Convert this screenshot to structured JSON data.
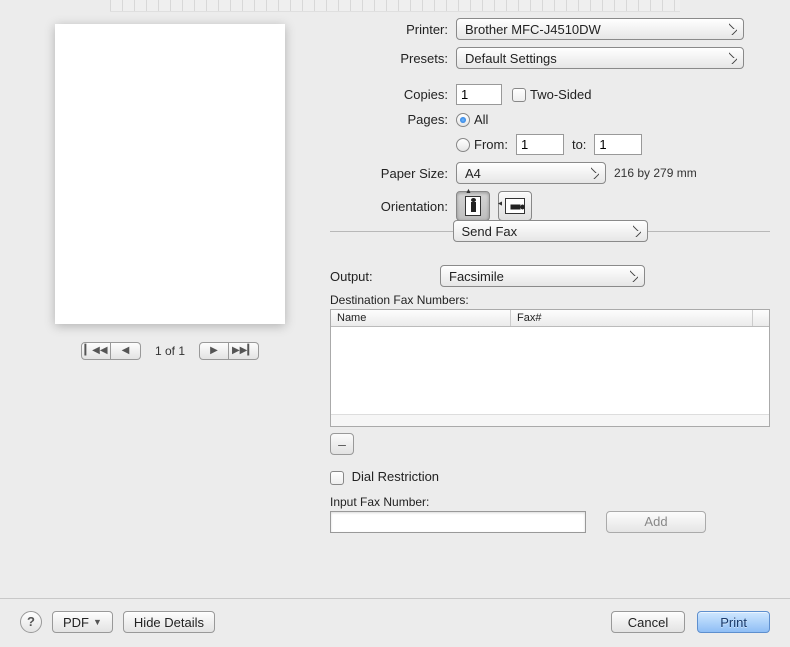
{
  "labels": {
    "printer": "Printer:",
    "presets": "Presets:",
    "copies": "Copies:",
    "two_sided": "Two-Sided",
    "pages": "Pages:",
    "all": "All",
    "from": "From:",
    "to": "to:",
    "paper_size": "Paper Size:",
    "orientation": "Orientation:",
    "output": "Output:",
    "dest_fax": "Destination Fax Numbers:",
    "col_name": "Name",
    "col_fax": "Fax#",
    "dial_restriction": "Dial Restriction",
    "input_fax": "Input Fax Number:"
  },
  "values": {
    "printer": "Brother MFC-J4510DW",
    "presets": "Default Settings",
    "copies": "1",
    "from": "1",
    "to": "1",
    "paper_size": "A4",
    "paper_dim": "216 by 279 mm",
    "pane": "Send Fax",
    "output": "Facsimile",
    "page_of": "1 of 1",
    "fax_number": ""
  },
  "buttons": {
    "minus": "–",
    "add": "Add",
    "help": "?",
    "pdf": "PDF",
    "hide_details": "Hide Details",
    "cancel": "Cancel",
    "print": "Print"
  },
  "state": {
    "pages_all_selected": true,
    "two_sided_checked": false,
    "dial_restriction_checked": false,
    "orientation_portrait": true
  }
}
